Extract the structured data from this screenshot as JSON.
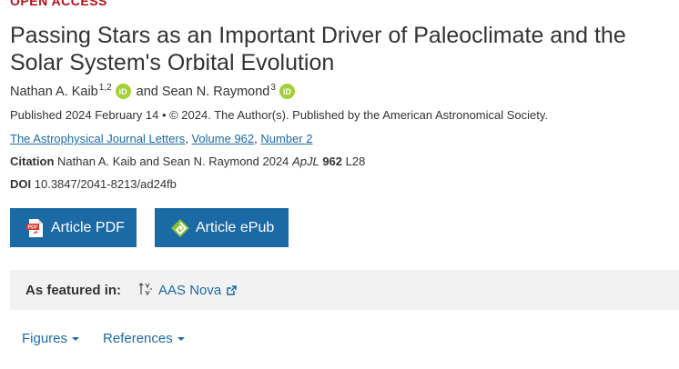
{
  "header": {
    "access_label": "OPEN ACCESS",
    "title": "Passing Stars as an Important Driver of Paleoclimate and the Solar System's Orbital Evolution"
  },
  "authors": [
    {
      "name": "Nathan A. Kaib",
      "affiliation": "1,2",
      "orcid_icon": "iD"
    },
    {
      "name": "Sean N. Raymond",
      "affiliation": "3",
      "orcid_icon": "iD"
    }
  ],
  "authors_joiner": "and",
  "published": "Published 2024 February 14 • © 2024. The Author(s). Published by the American Astronomical Society.",
  "journal_links": {
    "journal": "The Astrophysical Journal Letters",
    "volume": "Volume 962",
    "number": "Number 2",
    "sep": ","
  },
  "citation": {
    "label": "Citation",
    "text": "Nathan A. Kaib and Sean N. Raymond 2024",
    "journal_abbr": "ApJL",
    "volume": "962",
    "page": "L28"
  },
  "doi": {
    "label": "DOI",
    "value": "10.3847/2041-8213/ad24fb"
  },
  "buttons": {
    "pdf": "Article PDF",
    "epub": "Article ePub"
  },
  "featured": {
    "label": "As featured in:",
    "link": "AAS Nova"
  },
  "tabs": [
    "Figures",
    "References"
  ],
  "colors": {
    "accent_blue": "#1c6aa5",
    "open_access_red": "#b5111b",
    "orcid_green": "#a6ce39",
    "featured_bg": "#f2f2f2"
  }
}
